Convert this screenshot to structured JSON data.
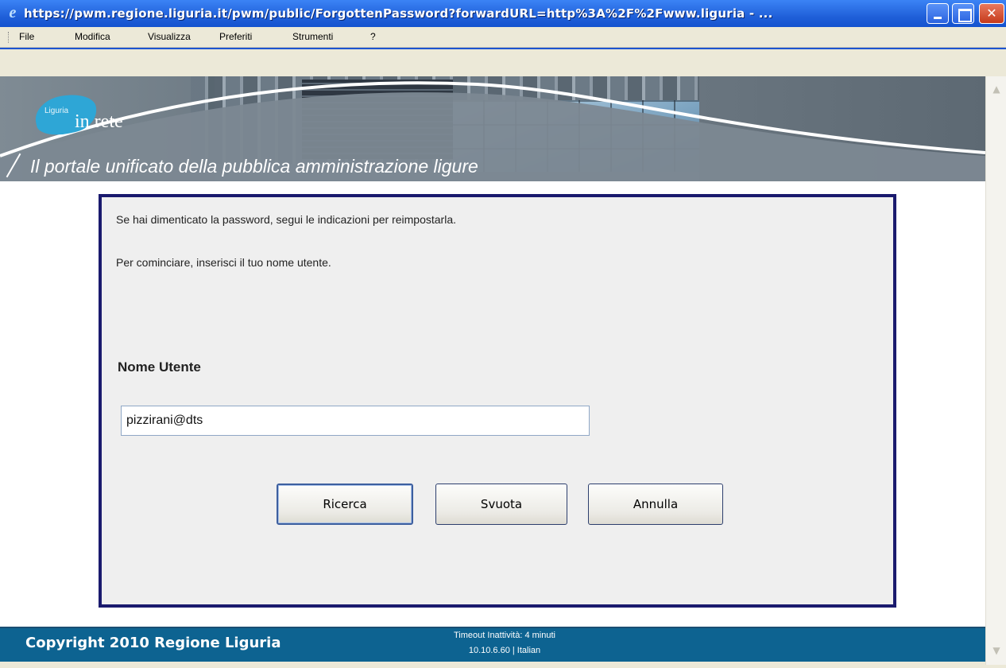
{
  "window": {
    "title": "https://pwm.regione.liguria.it/pwm/public/ForgottenPassword?forwardURL=http%3A%2F%2Fwww.liguria - ...",
    "app_icon": "ie-icon",
    "controls": [
      "minimize-icon",
      "maximize-icon",
      "close-icon"
    ]
  },
  "menu": {
    "items": [
      "File",
      "Modifica",
      "Visualizza",
      "Preferiti",
      "Strumenti",
      "?"
    ]
  },
  "banner": {
    "logo_small": "Liguria",
    "logo_main": "in rete",
    "tagline": "Il portale unificato della pubblica amministrazione ligure"
  },
  "form": {
    "intro1": "Se hai dimenticato la password, segui le indicazioni per reimpostarla.",
    "intro2": "Per cominciare, inserisci il tuo nome utente.",
    "username_label": "Nome Utente",
    "username_value": "pizzirani@dts",
    "buttons": {
      "search": "Ricerca",
      "clear": "Svuota",
      "cancel": "Annulla"
    }
  },
  "footer": {
    "copyright": "Copyright 2010 Regione Liguria",
    "timeout": "Timeout Inattività: 4 minuti",
    "server_info": "10.10.6.60 | Italian"
  },
  "colors": {
    "titlebar": "#1f5fd8",
    "panel_border": "#1a1a6e",
    "footer": "#0d6391"
  }
}
